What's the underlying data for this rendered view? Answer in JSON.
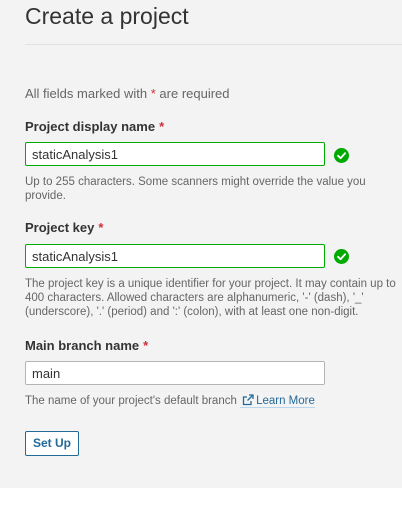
{
  "page": {
    "title": "Create a project",
    "required_note_prefix": "All fields marked with",
    "required_star": "*",
    "required_note_suffix": "are required"
  },
  "fields": {
    "display_name": {
      "label": "Project display name",
      "value": "staticAnalysis1",
      "help": "Up to 255 characters. Some scanners might override the value you provide.",
      "status_icon": "check-circle-icon",
      "status_color": "#00aa00"
    },
    "project_key": {
      "label": "Project key",
      "value": "staticAnalysis1",
      "help": "The project key is a unique identifier for your project. It may contain up to 400 characters. Allowed characters are alphanumeric, '-' (dash), '_' (underscore), '.' (period) and ':' (colon), with at least one non-digit.",
      "status_icon": "check-circle-icon",
      "status_color": "#00aa00"
    },
    "main_branch": {
      "label": "Main branch name",
      "value": "main",
      "help": "The name of your project's default branch",
      "link_icon": "external-link-icon",
      "link_label": "Learn More"
    }
  },
  "actions": {
    "setup_label": "Set Up"
  },
  "colors": {
    "accent": "#236a97",
    "required": "#d02f3a",
    "valid": "#00aa00",
    "panel_bg": "#f3f3f3"
  }
}
